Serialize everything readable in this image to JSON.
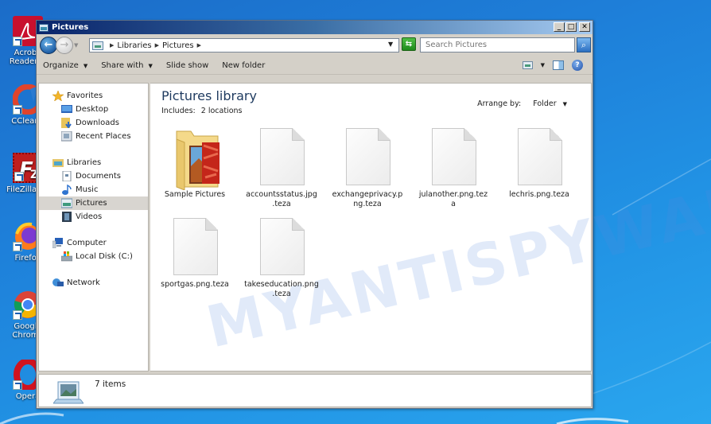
{
  "desktop": {
    "icons": [
      {
        "label": "Acrobat Reader DC",
        "line1": "Acroba",
        "line2": "Reader D",
        "icon": "acrobat-icon"
      },
      {
        "label": "CCleaner",
        "line1": "CCleane",
        "line2": "",
        "icon": "ccleaner-icon"
      },
      {
        "label": "FileZilla Client",
        "line1": "FileZilla Cli",
        "line2": "",
        "icon": "filezilla-icon"
      },
      {
        "label": "Firefox",
        "line1": "Firefox",
        "line2": "",
        "icon": "firefox-icon"
      },
      {
        "label": "Google Chrome",
        "line1": "Google",
        "line2": "Chrome",
        "icon": "chrome-icon"
      },
      {
        "label": "Opera",
        "line1": "Opera",
        "line2": "",
        "icon": "opera-icon"
      }
    ]
  },
  "window": {
    "title": "Pictures",
    "controls": {
      "minimize": "_",
      "maximize": "□",
      "close": "✕"
    }
  },
  "address": {
    "breadcrumb": [
      "Libraries",
      "Pictures"
    ],
    "search_placeholder": "Search Pictures",
    "back_glyph": "←",
    "refresh_glyph": "⇆",
    "search_glyph": "⌕"
  },
  "toolbar": {
    "organize": "Organize",
    "share_with": "Share with",
    "slide_show": "Slide show",
    "new_folder": "New folder",
    "help_glyph": "?"
  },
  "nav": {
    "favorites": {
      "label": "Favorites",
      "items": [
        "Desktop",
        "Downloads",
        "Recent Places"
      ]
    },
    "libraries": {
      "label": "Libraries",
      "items": [
        "Documents",
        "Music",
        "Pictures",
        "Videos"
      ],
      "selected": "Pictures"
    },
    "computer": {
      "label": "Computer",
      "items": [
        "Local Disk (C:)"
      ]
    },
    "network": {
      "label": "Network"
    }
  },
  "main": {
    "title": "Pictures library",
    "includes_label": "Includes:",
    "includes_value": "2 locations",
    "arrange_label": "Arrange by:",
    "arrange_value": "Folder",
    "files": [
      {
        "name": "Sample Pictures",
        "l1": "Sample Pictures",
        "l2": "",
        "type": "folder"
      },
      {
        "name": "accountsstatus.jpg.teza",
        "l1": "accountsstatus.jpg",
        "l2": ".teza",
        "type": "file"
      },
      {
        "name": "exchangeprivacy.png.teza",
        "l1": "exchangeprivacy.p",
        "l2": "ng.teza",
        "type": "file"
      },
      {
        "name": "julanother.png.teza",
        "l1": "julanother.png.tez",
        "l2": "a",
        "type": "file"
      },
      {
        "name": "lechris.png.teza",
        "l1": "lechris.png.teza",
        "l2": "",
        "type": "file"
      },
      {
        "name": "sportgas.png.teza",
        "l1": "sportgas.png.teza",
        "l2": "",
        "type": "file"
      },
      {
        "name": "takeseducation.png.teza",
        "l1": "takeseducation.png",
        "l2": ".teza",
        "type": "file"
      }
    ],
    "watermark": "MYANTISPYWARE.COM"
  },
  "status": {
    "count": "7 items"
  },
  "colors": {
    "title_bar": "#0a246a",
    "desktop": "#1e7fd9",
    "selection": "#d8d5d0"
  }
}
